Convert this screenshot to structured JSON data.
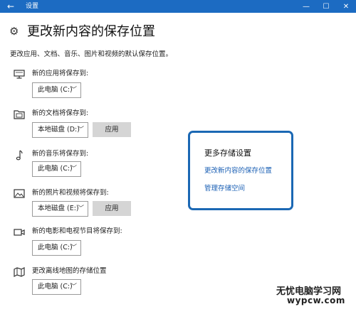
{
  "window": {
    "title": "设置",
    "back_icon": "←",
    "minimize_icon": "—",
    "maximize_icon": "☐",
    "close_icon": "✕"
  },
  "page": {
    "title": "更改新内容的保存位置",
    "description": "更改应用、文档、音乐、图片和视频的默认保存位置。"
  },
  "sections": [
    {
      "icon": "monitor-icon",
      "label": "新的应用将保存到:",
      "value": "此电脑 (C:)"
    },
    {
      "icon": "document-folder-icon",
      "label": "新的文档将保存到:",
      "value": "本地磁盘 (D:)",
      "apply_label": "应用"
    },
    {
      "icon": "music-note-icon",
      "label": "新的音乐将保存到:",
      "value": "此电脑 (C:)"
    },
    {
      "icon": "picture-icon",
      "label": "新的照片和视频将保存到:",
      "value": "本地磁盘 (E:)",
      "apply_label": "应用"
    },
    {
      "icon": "video-camera-icon",
      "label": "新的电影和电视节目将保存到:",
      "value": "此电脑 (C:)"
    },
    {
      "icon": "map-icon",
      "label": "更改离线地图的存储位置",
      "value": "此电脑 (C:)"
    }
  ],
  "more_storage": {
    "title": "更多存储设置",
    "link1": "更改新内容的保存位置",
    "link2": "管理存储空间"
  },
  "watermark": {
    "line1": "无忧电脑学习网",
    "line2": "wypcw.com"
  },
  "colors": {
    "titlebar": "#1c6bc2",
    "highlight_border": "#1b68b4",
    "link": "#1a5fb4",
    "apply_button": "#d5d5d5"
  }
}
